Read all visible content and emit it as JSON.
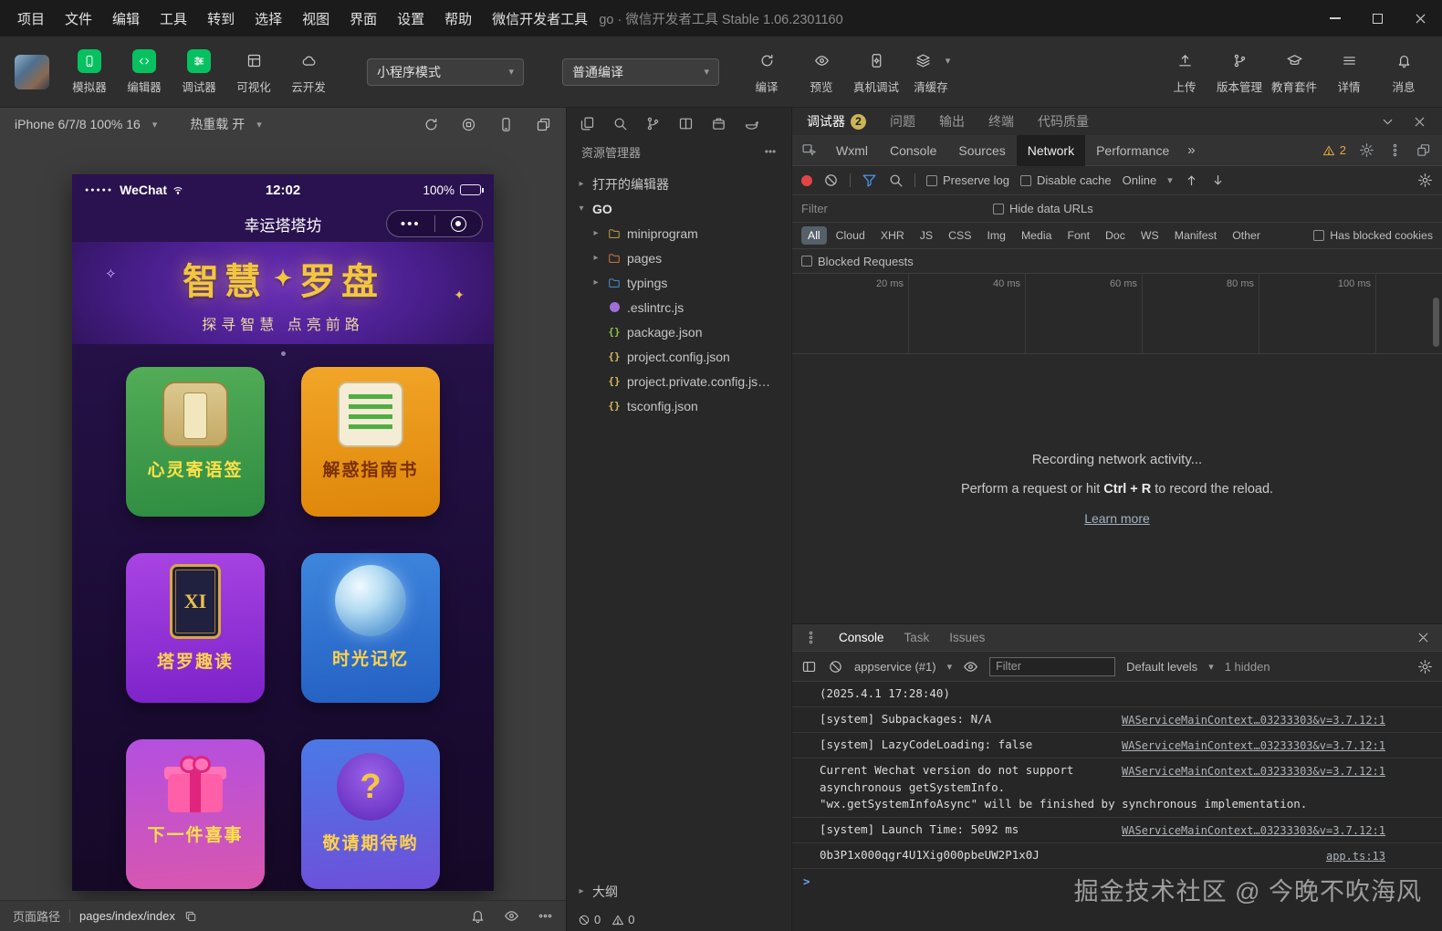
{
  "colors": {
    "wechat_green": "#07c160",
    "record_red": "#e04646",
    "filter_blue": "#4d9ef6",
    "warning_yellow": "#e2a93d"
  },
  "titlebar": {
    "menus": [
      "项目",
      "文件",
      "编辑",
      "工具",
      "转到",
      "选择",
      "视图",
      "界面",
      "设置",
      "帮助",
      "微信开发者工具"
    ],
    "window_title": "go · 微信开发者工具 Stable 1.06.2301160"
  },
  "toolbar": {
    "simulator": "模拟器",
    "editor": "编辑器",
    "debugger": "调试器",
    "visualization": "可视化",
    "cloud_dev": "云开发",
    "mode_select": "小程序模式",
    "compile_select": "普通编译",
    "compile": "编译",
    "preview": "预览",
    "device_debug": "真机调试",
    "clear_cache": "清缓存",
    "upload": "上传",
    "version_control": "版本管理",
    "edu_kit": "教育套件",
    "details": "详情",
    "messages": "消息"
  },
  "simulator": {
    "device": "iPhone 6/7/8 100% 16",
    "hot_reload": "热重载 开",
    "footer_label": "页面路径",
    "page_path": "pages/index/index",
    "phone": {
      "signal": "●●●●●",
      "carrier": "WeChat",
      "time": "12:02",
      "battery": "100%",
      "nav_title": "幸运塔塔坊",
      "capsule_dots": "•••",
      "sparkle_left": "✧",
      "sparkle_right": "✦",
      "banner_title_left": "智慧",
      "banner_star": "✦",
      "banner_title_right": "罗盘",
      "banner_subtitle": "探寻智慧 点亮前路",
      "cards": [
        {
          "label": "心灵寄语签"
        },
        {
          "label": "解惑指南书"
        },
        {
          "label": "塔罗趣读",
          "icon_text": "XI"
        },
        {
          "label": "时光记忆"
        },
        {
          "label": "下一件喜事"
        },
        {
          "label": "敬请期待哟",
          "icon_text": "?"
        }
      ]
    }
  },
  "explorer": {
    "title": "资源管理器",
    "open_editors": "打开的编辑器",
    "project": "GO",
    "tree": [
      {
        "label": "miniprogram"
      },
      {
        "label": "pages"
      },
      {
        "label": "typings"
      },
      {
        "label": ".eslintrc.js"
      },
      {
        "label": "package.json"
      },
      {
        "label": "project.config.json"
      },
      {
        "label": "project.private.config.js…"
      },
      {
        "label": "tsconfig.json"
      }
    ],
    "outline": "大纲",
    "errors": "0",
    "warnings": "0"
  },
  "debugger": {
    "tabs": [
      "调试器",
      "问题",
      "输出",
      "终端",
      "代码质量"
    ],
    "debugger_badge": "2",
    "devtools_tabs": [
      "Wxml",
      "Console",
      "Sources",
      "Network",
      "Performance"
    ],
    "more_glyph": "»",
    "warning_count": "2",
    "network": {
      "preserve_log": "Preserve log",
      "disable_cache": "Disable cache",
      "throttling": "Online",
      "filter_placeholder": "Filter",
      "hide_data_urls": "Hide data URLs",
      "type_filters": [
        "All",
        "Cloud",
        "XHR",
        "JS",
        "CSS",
        "Img",
        "Media",
        "Font",
        "Doc",
        "WS",
        "Manifest",
        "Other"
      ],
      "has_blocked_cookies": "Has blocked cookies",
      "blocked_requests": "Blocked Requests",
      "ticks": [
        "20 ms",
        "40 ms",
        "60 ms",
        "80 ms",
        "100 ms"
      ],
      "empty_title": "Recording network activity...",
      "hint_pre": "Perform a request or hit ",
      "hint_key": "Ctrl + R",
      "hint_post": " to record the reload.",
      "learn_more": "Learn more"
    },
    "console": {
      "tabs": [
        "Console",
        "Task",
        "Issues"
      ],
      "context": "appservice (#1)",
      "filter_placeholder": "Filter",
      "levels": "Default levels",
      "hidden_count": "1 hidden",
      "timestamp": "(2025.4.1 17:28:40)",
      "logs": [
        {
          "text": "[system] Subpackages: N/A",
          "link": "WAServiceMainContext…03233303&v=3.7.12:1"
        },
        {
          "text": "[system] LazyCodeLoading: false",
          "link": "WAServiceMainContext…03233303&v=3.7.12:1"
        },
        {
          "text": "Current Wechat version do not support asynchronous getSystemInfo. \"wx.getSystemInfoAsync\" will be finished by synchronous implementation.",
          "link": "WAServiceMainContext…03233303&v=3.7.12:1"
        },
        {
          "text": "[system] Launch Time: 5092 ms",
          "link": "WAServiceMainContext…03233303&v=3.7.12:1"
        },
        {
          "text": "0b3P1x000qgr4U1Xig000pbeUW2P1x0J",
          "link": "app.ts:13"
        }
      ],
      "prompt": ">"
    }
  },
  "watermark": "掘金技术社区 @ 今晚不吹海风"
}
